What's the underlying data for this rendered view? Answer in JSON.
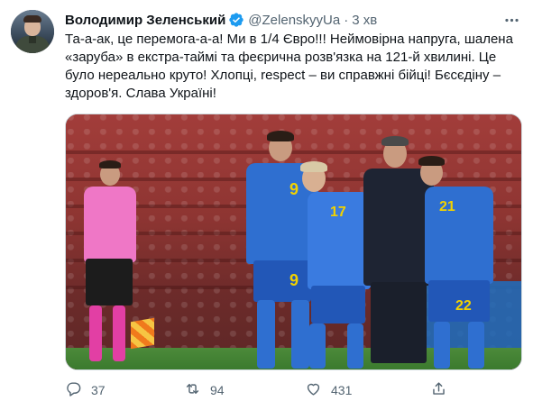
{
  "author": {
    "name": "Володимир Зеленський",
    "handle": "@ZelenskyyUa",
    "separator": "·",
    "time": "3 хв"
  },
  "tweet": {
    "text": "Та-а-ак, це перемога-а-а! Ми в 1/4 Євро!!! Неймовірна напруга, шалена «заруба» в екстра-таймі та феєрична розв'язка на 121-й хвилині. Це було нереально круто! Хлопці, respect – ви справжні бійці! Бєсєдіну – здоров'я. Слава Україні!"
  },
  "media": {
    "jersey_numbers": [
      "9",
      "9",
      "17",
      "21",
      "22"
    ]
  },
  "actions": {
    "reply_count": "37",
    "retweet_count": "94",
    "like_count": "431"
  },
  "icons": [
    "verified-badge-icon",
    "more-icon",
    "reply-icon",
    "retweet-icon",
    "like-icon",
    "share-icon"
  ],
  "colors": {
    "verified": "#1d9bf0",
    "secondary_text": "#536471",
    "accent_yellow": "#f2d200",
    "kit_blue": "#2f6fd0"
  }
}
